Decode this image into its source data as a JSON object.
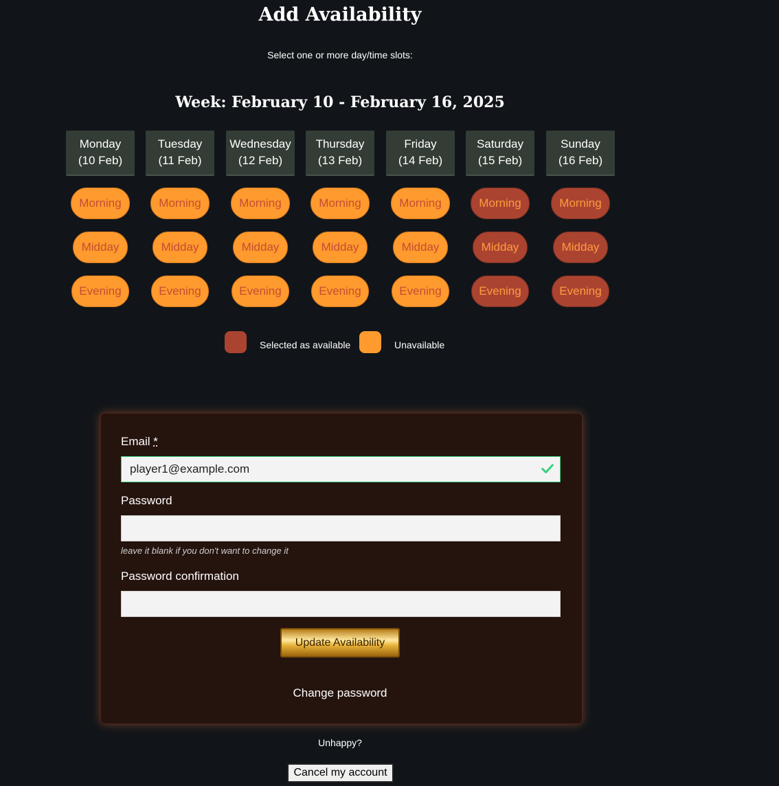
{
  "page": {
    "title": "Add Availability",
    "subtitle": "Select one or more day/time slots:"
  },
  "calendar": {
    "week_label": "Week: February 10 - February 16, 2025",
    "days": [
      {
        "name": "Monday",
        "date": "(10 Feb)"
      },
      {
        "name": "Tuesday",
        "date": "(11 Feb)"
      },
      {
        "name": "Wednesday",
        "date": "(12 Feb)"
      },
      {
        "name": "Thursday",
        "date": "(13 Feb)"
      },
      {
        "name": "Friday",
        "date": "(14 Feb)"
      },
      {
        "name": "Saturday",
        "date": "(15 Feb)"
      },
      {
        "name": "Sunday",
        "date": "(16 Feb)"
      }
    ],
    "slot_labels": [
      "Morning",
      "Midday",
      "Evening"
    ],
    "selected": [
      [
        false,
        false,
        false
      ],
      [
        false,
        false,
        false
      ],
      [
        false,
        false,
        false
      ],
      [
        false,
        false,
        false
      ],
      [
        false,
        false,
        false
      ],
      [
        true,
        true,
        true
      ],
      [
        true,
        true,
        true
      ]
    ],
    "colors": {
      "unavailable": "#ff9a2e",
      "selected": "#aa4430"
    }
  },
  "legend": {
    "selected_label": "Selected as available",
    "unavailable_label": "Unavailable"
  },
  "form": {
    "email_label": "Email",
    "email_required_marker": "*",
    "email_value": "player1@example.com",
    "password_label": "Password",
    "password_value": "",
    "password_hint": "leave it blank if you don't want to change it",
    "password_confirmation_label": "Password confirmation",
    "password_confirmation_value": "",
    "submit_label": "Update Availability",
    "change_password_link": "Change password"
  },
  "footer": {
    "unhappy_text": "Unhappy?",
    "cancel_label": "Cancel my account"
  }
}
